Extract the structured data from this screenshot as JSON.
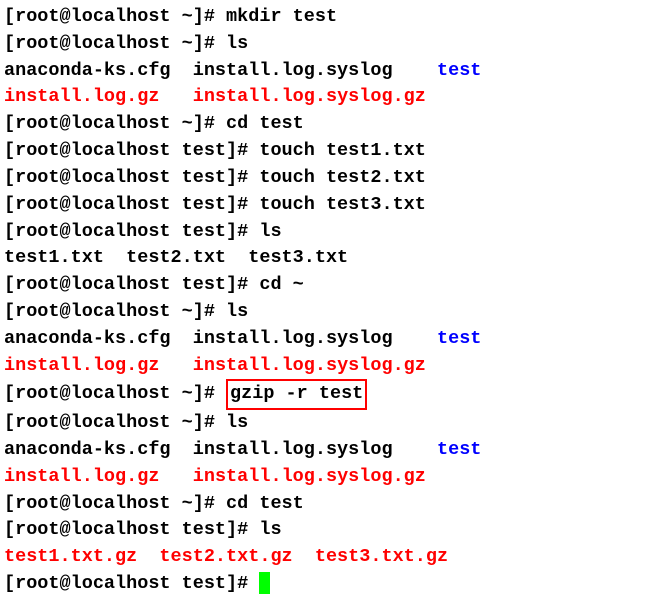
{
  "l1": "[root@localhost ~]# mkdir test",
  "l2": "[root@localhost ~]# ls",
  "l3a": "anaconda-ks.cfg  install.log.syslog    ",
  "l3b": "test",
  "l4a": "install.log.gz",
  "l4s": "   ",
  "l4b": "install.log.syslog.gz",
  "l5": "[root@localhost ~]# cd test",
  "l6": "[root@localhost test]# touch test1.txt",
  "l7": "[root@localhost test]# touch test2.txt",
  "l8": "[root@localhost test]# touch test3.txt",
  "l9": "[root@localhost test]# ls",
  "l10": "test1.txt  test2.txt  test3.txt",
  "l11": "[root@localhost test]# cd ~",
  "l12": "[root@localhost ~]# ls",
  "l13a": "anaconda-ks.cfg  install.log.syslog    ",
  "l13b": "test",
  "l14a": "install.log.gz",
  "l14s": "   ",
  "l14b": "install.log.syslog.gz",
  "l15a": "[root@localhost ~]# ",
  "l15b": "gzip -r test",
  "l16": "[root@localhost ~]# ls",
  "l17a": "anaconda-ks.cfg  install.log.syslog    ",
  "l17b": "test",
  "l18a": "install.log.gz",
  "l18s": "   ",
  "l18b": "install.log.syslog.gz",
  "l19": "[root@localhost ~]# cd test",
  "l20": "[root@localhost test]# ls",
  "l21a": "test1.txt.gz  test2.txt.gz  test3.txt.gz",
  "l22": "[root@localhost test]# "
}
